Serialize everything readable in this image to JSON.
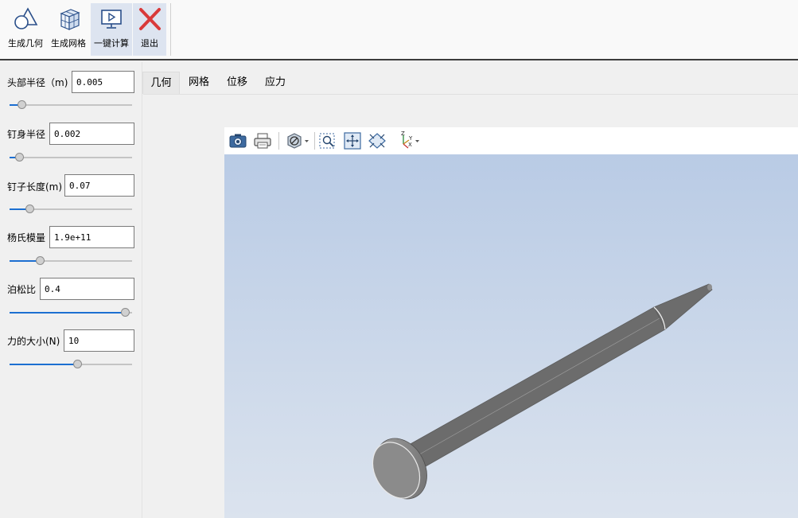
{
  "toolbar": {
    "buttons": [
      {
        "label": "生成几何",
        "icon": "geometry-icon"
      },
      {
        "label": "生成网格",
        "icon": "mesh-cube-icon"
      },
      {
        "label": "一键计算",
        "icon": "run-monitor-icon"
      },
      {
        "label": "退出",
        "icon": "exit-x-icon"
      }
    ]
  },
  "params": [
    {
      "label": "头部半径（m)",
      "value": "0.005",
      "slider_fraction": 0.07
    },
    {
      "label": "钉身半径",
      "value": "0.002",
      "slider_fraction": 0.05
    },
    {
      "label": "钉子长度(m)",
      "value": "0.07",
      "slider_fraction": 0.14
    },
    {
      "label": "杨氏模量",
      "value": "1.9e+11",
      "slider_fraction": 0.23
    },
    {
      "label": "泊松比",
      "value": "0.4",
      "slider_fraction": 0.98
    },
    {
      "label": "力的大小(N)",
      "value": "10",
      "slider_fraction": 0.56
    }
  ],
  "tabs": [
    "几何",
    "网格",
    "位移",
    "应力"
  ],
  "active_tab": "几何",
  "view_toolbar": {
    "icons": [
      "camera-icon",
      "print-icon",
      "render-style-icon",
      "zoom-box-icon",
      "fit-view-icon",
      "reset-view-icon",
      "axes-orientation-icon"
    ],
    "axes_labels": {
      "z": "Z",
      "y": "Y",
      "x": "X"
    }
  },
  "colors": {
    "accent": "#1c6fd1",
    "exit_red": "#d93a3a",
    "viewport_top": "#b9cbe5",
    "viewport_bottom": "#dbe3ee"
  }
}
